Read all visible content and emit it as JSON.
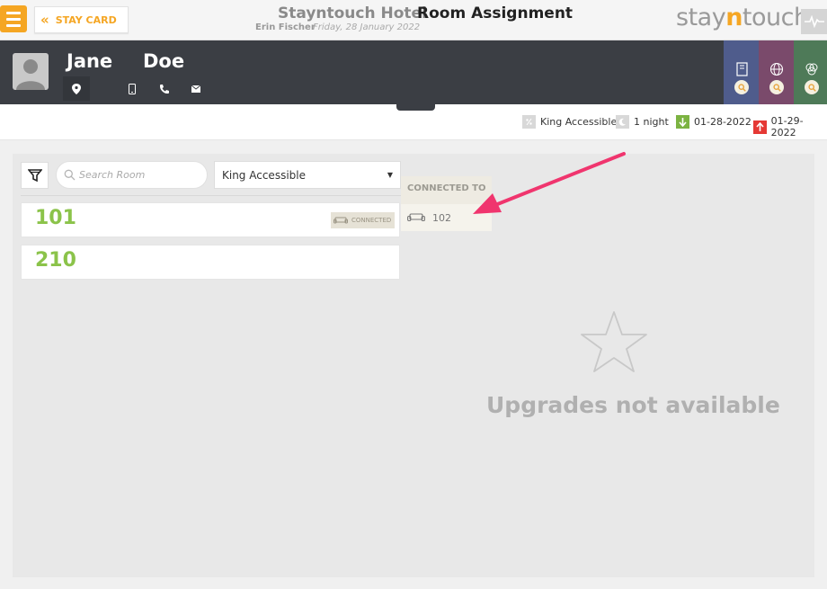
{
  "header": {
    "back_label": "STAY CARD",
    "hotel_name": "Stayntouch Hotel",
    "page_title": "Room Assignment",
    "user_name": "Erin Fischer",
    "date": "Friday, 28 January 2022",
    "brand": {
      "pre": "stay",
      "mid": "n",
      "post": "touch"
    }
  },
  "guest": {
    "first_name": "Jane",
    "last_name": "Doe",
    "icons": [
      "location-icon",
      "phone-icon",
      "landline-icon",
      "email-icon"
    ],
    "tab_colors": [
      "#4f5c8c",
      "#7a4a6b",
      "#4e7a58"
    ]
  },
  "summary": {
    "room_type": "King Accessible",
    "nights": "1 night",
    "arrival": "01-28-2022",
    "departure": "01-29-2022",
    "colors": {
      "arrival": "#7cb342",
      "departure": "#e53935"
    }
  },
  "filters": {
    "search_placeholder": "Search Room",
    "room_type_selected": "King Accessible"
  },
  "rooms": [
    {
      "number": "101",
      "badge": "CONNECTED"
    },
    {
      "number": "210"
    }
  ],
  "connected": {
    "title": "CONNECTED TO",
    "room": "102"
  },
  "upgrades": {
    "message": "Upgrades not available"
  },
  "colors": {
    "accent": "#f5a623",
    "room_number": "#8bc34a",
    "annotation_arrow": "#f0356e"
  }
}
